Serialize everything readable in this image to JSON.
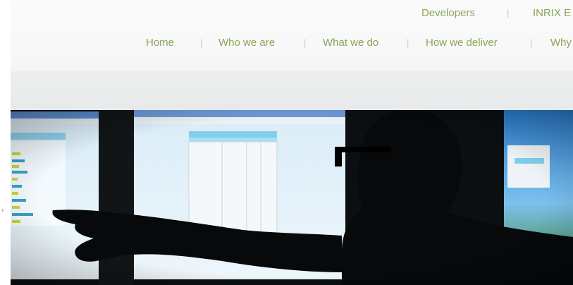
{
  "top_links": {
    "developers": "Developers",
    "inrix_truncated": "INRIX E"
  },
  "main_nav": {
    "items": [
      {
        "label": "Home"
      },
      {
        "label": "Who we are"
      },
      {
        "label": "What we do"
      },
      {
        "label": "How we deliver"
      },
      {
        "label": "Why"
      }
    ]
  },
  "colors": {
    "nav_link": "#8aa55a",
    "header_bg": "#f8f8f8",
    "subbar_bg": "#e9ebec",
    "screen_sheet_header": "#7fd0ea"
  },
  "hero": {
    "image_subject": "silhouette-person-pointing-at-monitors"
  }
}
